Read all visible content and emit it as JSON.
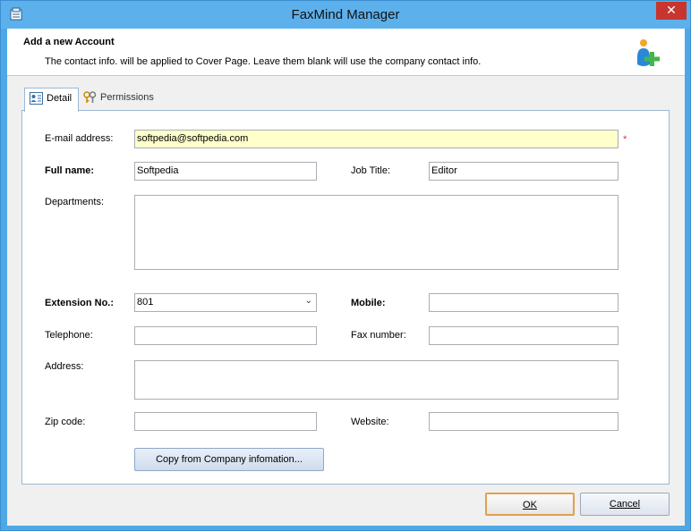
{
  "window": {
    "title": "FaxMind Manager"
  },
  "header": {
    "title": "Add a new Account",
    "description": "The contact info. will be applied to Cover Page. Leave them blank will use the company contact info."
  },
  "tabs": [
    {
      "label": "Detail",
      "icon": "contact-card-icon"
    },
    {
      "label": "Permissions",
      "icon": "permission-keys-icon"
    }
  ],
  "form": {
    "email": {
      "label": "E-mail address:",
      "value": "softpedia@softpedia.com",
      "required_mark": "*"
    },
    "full_name": {
      "label": "Full name:",
      "value": "Softpedia"
    },
    "job_title": {
      "label": "Job Title:",
      "value": "Editor"
    },
    "departments": {
      "label": "Departments:",
      "value": ""
    },
    "extension": {
      "label": "Extension No.:",
      "value": "801"
    },
    "mobile": {
      "label": "Mobile:",
      "value": ""
    },
    "telephone": {
      "label": "Telephone:",
      "value": ""
    },
    "fax_number": {
      "label": "Fax number:",
      "value": ""
    },
    "address": {
      "label": "Address:",
      "value": ""
    },
    "zip_code": {
      "label": "Zip code:",
      "value": ""
    },
    "website": {
      "label": "Website:",
      "value": ""
    }
  },
  "buttons": {
    "copy": "Copy from Company infomation...",
    "ok": "OK",
    "cancel": "Cancel"
  },
  "colors": {
    "title_bar": "#5cb0ec",
    "close": "#c7352e",
    "required_highlight": "#ffffcc"
  }
}
